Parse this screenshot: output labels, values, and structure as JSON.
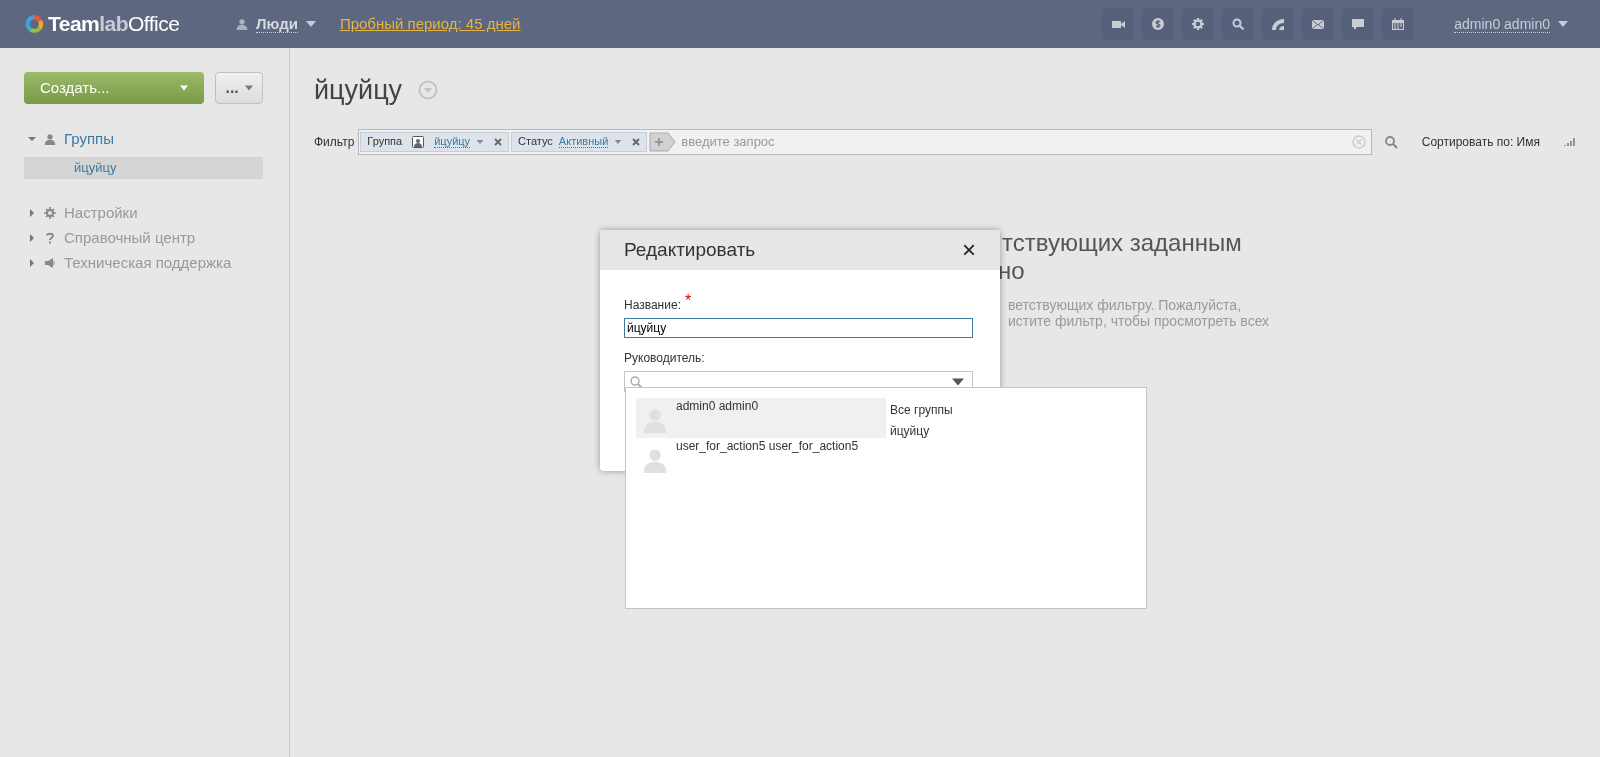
{
  "topbar": {
    "logo": {
      "bold": "Team",
      "light": "lab",
      "rest": "Office"
    },
    "module": "Люди",
    "trial_link": "Пробный период: 45 дней",
    "user": "admin0 admin0"
  },
  "sidebar": {
    "create_button": "Создать...",
    "more_button": "...",
    "groups": {
      "label": "Группы",
      "expanded": true,
      "children": [
        {
          "label": "йцуйцу",
          "selected": true
        }
      ]
    },
    "links": [
      {
        "label": "Настройки",
        "kind": "settings",
        "expanded": false
      },
      {
        "label": "Справочный центр",
        "kind": "help",
        "expanded": false
      },
      {
        "label": "Техническая поддержка",
        "kind": "support",
        "expanded": false
      }
    ]
  },
  "main": {
    "title": "йцуйцу",
    "filter": {
      "label": "Фильтр",
      "chips": [
        {
          "label": "Группа",
          "value": "йцуйцу",
          "kind": "group"
        },
        {
          "label": "Статус",
          "value": "Активный",
          "kind": "status"
        }
      ],
      "placeholder": "введите запрос"
    },
    "sort": "Сортировать по: Имя",
    "empty_state": {
      "heading": [
        "тствующих заданным",
        "но"
      ],
      "text": [
        "ветствующих фильтру. Пожалуйста,",
        "истите фильтр, чтобы просмотреть всех"
      ]
    }
  },
  "dialog": {
    "title": "Редактировать",
    "close": "×",
    "name_label": "Название:",
    "required_mark": "*",
    "name_value": "йцуйцу",
    "manager_label": "Руководитель:",
    "dropdown": {
      "users": [
        {
          "name": "admin0 admin0",
          "selected": true
        },
        {
          "name": "user_for_action5 user_for_action5",
          "selected": false
        }
      ],
      "groups": [
        "Все группы",
        "йцуйцу"
      ]
    }
  }
}
